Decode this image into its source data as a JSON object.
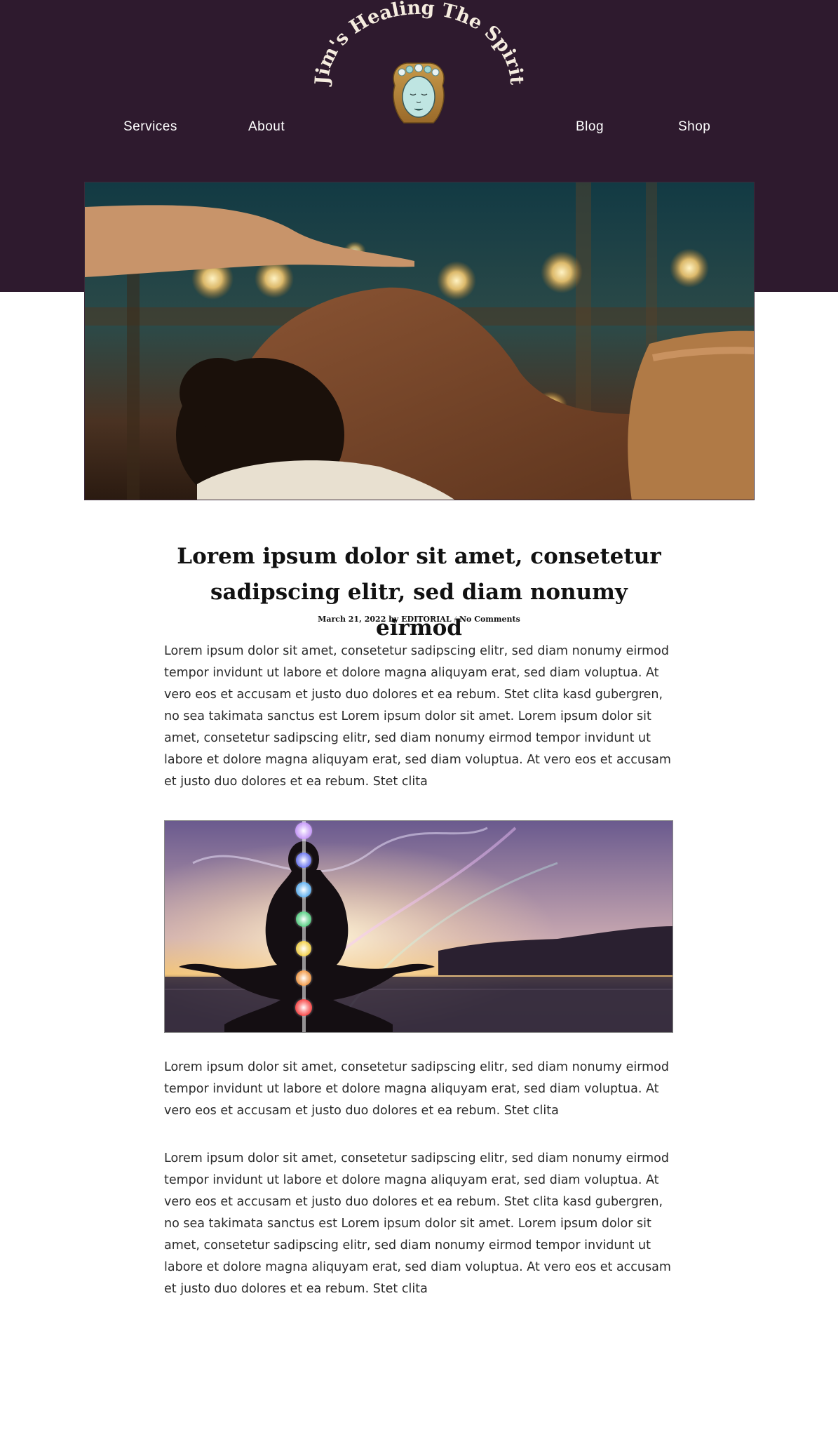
{
  "site": {
    "logo_text": "Jim's Healing The Spirit",
    "colors": {
      "header_bg": "#2e1a2e",
      "text": "#2a2a2a",
      "title": "#111111",
      "nav_text": "#ffffff"
    }
  },
  "nav": {
    "left": [
      {
        "label": "Services"
      },
      {
        "label": "About"
      }
    ],
    "right": [
      {
        "label": "Blog"
      },
      {
        "label": "Shop"
      }
    ]
  },
  "post": {
    "title": "Lorem ipsum dolor sit amet, consetetur sadipscing elitr, sed diam nonumy eirmod",
    "meta": {
      "date": "March 21, 2022",
      "by": "by",
      "author": "EDITORIAL",
      "separator": "/",
      "comments": "No Comments"
    },
    "paragraphs": [
      "Lorem ipsum dolor sit amet, consetetur sadipscing elitr, sed diam nonumy eirmod tempor invidunt ut labore et dolore magna aliquyam erat, sed diam voluptua. At vero eos et accusam et justo duo dolores et ea rebum. Stet clita kasd gubergren, no sea takimata sanctus est Lorem ipsum dolor sit amet. Lorem ipsum dolor sit amet, consetetur sadipscing elitr, sed diam nonumy eirmod tempor invidunt ut labore et dolore magna aliquyam erat, sed diam voluptua. At vero eos et accusam et justo duo dolores et ea rebum. Stet clita",
      "Lorem ipsum dolor sit amet, consetetur sadipscing elitr, sed diam nonumy eirmod tempor invidunt ut labore et dolore magna aliquyam erat, sed diam voluptua. At vero eos et accusam et justo duo dolores et ea rebum. Stet clita",
      "Lorem ipsum dolor sit amet, consetetur sadipscing elitr, sed diam nonumy eirmod tempor invidunt ut labore et dolore magna aliquyam erat, sed diam voluptua. At vero eos et accusam et justo duo dolores et ea rebum. Stet clita kasd gubergren, no sea takimata sanctus est Lorem ipsum dolor sit amet. Lorem ipsum dolor sit amet, consetetur sadipscing elitr, sed diam nonumy eirmod tempor invidunt ut labore et dolore magna aliquyam erat, sed diam voluptua. At vero eos et accusam et justo duo dolores et ea rebum. Stet clita"
    ]
  }
}
